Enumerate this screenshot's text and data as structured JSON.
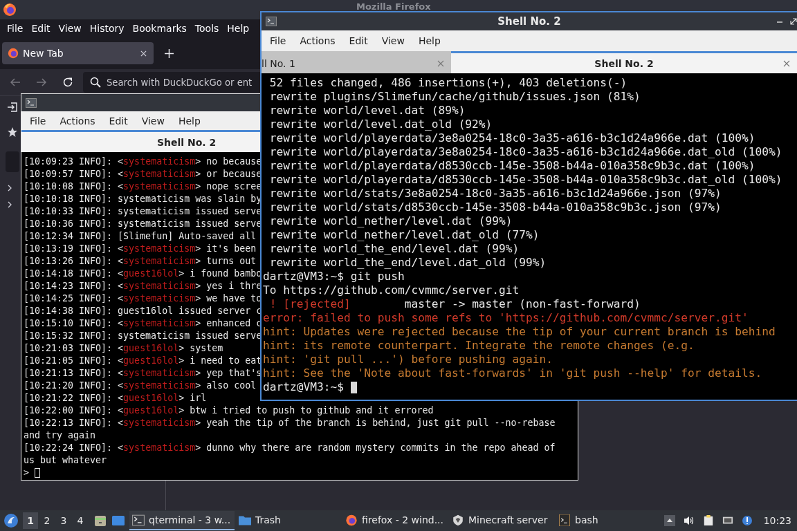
{
  "firefox": {
    "title": "Mozilla Firefox",
    "menu": [
      "File",
      "Edit",
      "View",
      "History",
      "Bookmarks",
      "Tools",
      "Help"
    ],
    "tabs": [
      {
        "label": "New Tab",
        "selected": true
      }
    ],
    "search": {
      "placeholder": "Search with DuckDuckGo or ent"
    }
  },
  "left_terminal": {
    "focused": false,
    "menu": [
      "File",
      "Actions",
      "Edit",
      "View",
      "Help"
    ],
    "tabs": [
      {
        "label": "Shell No. 2",
        "selected": true
      }
    ],
    "lines": [
      {
        "parts": [
          {
            "text": "[10:09:23 INFO]: <",
            "kind": "plain"
          },
          {
            "text": "systematicism",
            "kind": "name"
          },
          {
            "text": "> no because",
            "kind": "plain"
          }
        ]
      },
      {
        "parts": [
          {
            "text": "[10:09:57 INFO]: <",
            "kind": "plain"
          },
          {
            "text": "systematicism",
            "kind": "name"
          },
          {
            "text": "> or because",
            "kind": "plain"
          }
        ]
      },
      {
        "parts": [
          {
            "text": "[10:10:08 INFO]: <",
            "kind": "plain"
          },
          {
            "text": "systematicism",
            "kind": "name"
          },
          {
            "text": "> nope scree",
            "kind": "plain"
          }
        ]
      },
      {
        "parts": [
          {
            "text": "[10:10:18 INFO]: systematicism was slain by",
            "kind": "plain"
          }
        ]
      },
      {
        "parts": [
          {
            "text": "[10:10:33 INFO]: systematicism issued serve",
            "kind": "plain"
          }
        ]
      },
      {
        "parts": [
          {
            "text": "[10:10:36 INFO]: systematicism issued serve",
            "kind": "plain"
          }
        ]
      },
      {
        "parts": [
          {
            "text": "[10:12:34 INFO]: [Slimefun] Auto-saved all",
            "kind": "plain"
          }
        ]
      },
      {
        "parts": [
          {
            "text": "[10:13:19 INFO]: <",
            "kind": "plain"
          },
          {
            "text": "systematicism",
            "kind": "name"
          },
          {
            "text": "> it's been",
            "kind": "plain"
          }
        ]
      },
      {
        "parts": [
          {
            "text": "[10:13:26 INFO]: <",
            "kind": "plain"
          },
          {
            "text": "systematicism",
            "kind": "name"
          },
          {
            "text": "> turns out",
            "kind": "plain"
          }
        ]
      },
      {
        "parts": [
          {
            "text": "[10:14:18 INFO]: <",
            "kind": "plain"
          },
          {
            "text": "guest16lol",
            "kind": "name"
          },
          {
            "text": "> i found bambo",
            "kind": "plain"
          }
        ]
      },
      {
        "parts": [
          {
            "text": "[10:14:23 INFO]: <",
            "kind": "plain"
          },
          {
            "text": "systematicism",
            "kind": "name"
          },
          {
            "text": "> yes i thre",
            "kind": "plain"
          }
        ]
      },
      {
        "parts": [
          {
            "text": "[10:14:25 INFO]: <",
            "kind": "plain"
          },
          {
            "text": "systematicism",
            "kind": "name"
          },
          {
            "text": "> we have to",
            "kind": "plain"
          }
        ]
      },
      {
        "parts": [
          {
            "text": "[10:14:38 INFO]: guest16lol issued server c",
            "kind": "plain"
          }
        ]
      },
      {
        "parts": [
          {
            "text": "[10:15:10 INFO]: <",
            "kind": "plain"
          },
          {
            "text": "systematicism",
            "kind": "name"
          },
          {
            "text": "> enhanced c",
            "kind": "plain"
          }
        ]
      },
      {
        "parts": [
          {
            "text": "[10:15:32 INFO]: systematicism issued serve",
            "kind": "plain"
          }
        ]
      },
      {
        "parts": [
          {
            "text": "[10:21:03 INFO]: <",
            "kind": "plain"
          },
          {
            "text": "guest16lol",
            "kind": "name"
          },
          {
            "text": "> system",
            "kind": "plain"
          }
        ]
      },
      {
        "parts": [
          {
            "text": "[10:21:05 INFO]: <",
            "kind": "plain"
          },
          {
            "text": "guest16lol",
            "kind": "name"
          },
          {
            "text": "> i need to eat",
            "kind": "plain"
          }
        ]
      },
      {
        "parts": [
          {
            "text": "[10:21:13 INFO]: <",
            "kind": "plain"
          },
          {
            "text": "systematicism",
            "kind": "name"
          },
          {
            "text": "> yep that's",
            "kind": "plain"
          }
        ]
      },
      {
        "parts": [
          {
            "text": "[10:21:20 INFO]: <",
            "kind": "plain"
          },
          {
            "text": "systematicism",
            "kind": "name"
          },
          {
            "text": "> also cool",
            "kind": "plain"
          }
        ]
      },
      {
        "parts": [
          {
            "text": "[10:21:22 INFO]: <",
            "kind": "plain"
          },
          {
            "text": "guest16lol",
            "kind": "name"
          },
          {
            "text": "> irl",
            "kind": "plain"
          }
        ]
      },
      {
        "parts": [
          {
            "text": "[10:22:00 INFO]: <",
            "kind": "plain"
          },
          {
            "text": "guest16lol",
            "kind": "name"
          },
          {
            "text": "> btw i tried to push to github and it errored",
            "kind": "plain"
          }
        ]
      },
      {
        "parts": [
          {
            "text": "[10:22:13 INFO]: <",
            "kind": "plain"
          },
          {
            "text": "systematicism",
            "kind": "name"
          },
          {
            "text": "> yeah the tip of the branch is behind, just git pull --no-rebase",
            "kind": "plain"
          }
        ]
      },
      {
        "parts": [
          {
            "text": "and try again",
            "kind": "plain"
          }
        ]
      },
      {
        "parts": [
          {
            "text": "[10:22:24 INFO]: <",
            "kind": "plain"
          },
          {
            "text": "systematicism",
            "kind": "name"
          },
          {
            "text": "> dunno why there are random mystery commits in the repo ahead of",
            "kind": "plain"
          }
        ]
      },
      {
        "parts": [
          {
            "text": "us but whatever",
            "kind": "plain"
          }
        ]
      },
      {
        "parts": [
          {
            "text": ">",
            "kind": "plain"
          }
        ],
        "cursor": true
      }
    ]
  },
  "right_terminal": {
    "focused": true,
    "title": "Shell No. 2",
    "menu": [
      "File",
      "Actions",
      "Edit",
      "View",
      "Help"
    ],
    "tabs": [
      {
        "label": "ll No. 1",
        "selected": false
      },
      {
        "label": "Shell No. 2",
        "selected": true
      }
    ],
    "lines": [
      {
        "parts": [
          {
            "text": " 52 files changed, 486 insertions(+), 403 deletions(-)",
            "kind": "plain"
          }
        ]
      },
      {
        "parts": [
          {
            "text": " rewrite plugins/Slimefun/cache/github/issues.json (81%)",
            "kind": "plain"
          }
        ]
      },
      {
        "parts": [
          {
            "text": " rewrite world/level.dat (89%)",
            "kind": "plain"
          }
        ]
      },
      {
        "parts": [
          {
            "text": " rewrite world/level.dat_old (92%)",
            "kind": "plain"
          }
        ]
      },
      {
        "parts": [
          {
            "text": " rewrite world/playerdata/3e8a0254-18c0-3a35-a616-b3c1d24a966e.dat (100%)",
            "kind": "plain"
          }
        ]
      },
      {
        "parts": [
          {
            "text": " rewrite world/playerdata/3e8a0254-18c0-3a35-a616-b3c1d24a966e.dat_old (100%)",
            "kind": "plain"
          }
        ]
      },
      {
        "parts": [
          {
            "text": " rewrite world/playerdata/d8530ccb-145e-3508-b44a-010a358c9b3c.dat (100%)",
            "kind": "plain"
          }
        ]
      },
      {
        "parts": [
          {
            "text": " rewrite world/playerdata/d8530ccb-145e-3508-b44a-010a358c9b3c.dat_old (100%)",
            "kind": "plain"
          }
        ]
      },
      {
        "parts": [
          {
            "text": " rewrite world/stats/3e8a0254-18c0-3a35-a616-b3c1d24a966e.json (97%)",
            "kind": "plain"
          }
        ]
      },
      {
        "parts": [
          {
            "text": " rewrite world/stats/d8530ccb-145e-3508-b44a-010a358c9b3c.json (97%)",
            "kind": "plain"
          }
        ]
      },
      {
        "parts": [
          {
            "text": " rewrite world_nether/level.dat (99%)",
            "kind": "plain"
          }
        ]
      },
      {
        "parts": [
          {
            "text": " rewrite world_nether/level.dat_old (77%)",
            "kind": "plain"
          }
        ]
      },
      {
        "parts": [
          {
            "text": " rewrite world_the_end/level.dat (99%)",
            "kind": "plain"
          }
        ]
      },
      {
        "parts": [
          {
            "text": " rewrite world_the_end/level.dat_old (99%)",
            "kind": "plain"
          }
        ]
      },
      {
        "parts": [
          {
            "text": "dartz@VM3:~$ git push",
            "kind": "plain"
          }
        ]
      },
      {
        "parts": [
          {
            "text": "To https://github.com/cvmmc/server.git",
            "kind": "plain"
          }
        ]
      },
      {
        "parts": [
          {
            "text": " ! [rejected]",
            "kind": "error"
          },
          {
            "text": "        master -> master (non-fast-forward)",
            "kind": "plain"
          }
        ]
      },
      {
        "parts": [
          {
            "text": "error: failed to push some refs to 'https://github.com/cvmmc/server.git'",
            "kind": "error"
          }
        ]
      },
      {
        "parts": [
          {
            "text": "hint: Updates were rejected because the tip of your current branch is behind",
            "kind": "hint"
          }
        ]
      },
      {
        "parts": [
          {
            "text": "hint: its remote counterpart. Integrate the remote changes (e.g.",
            "kind": "hint"
          }
        ]
      },
      {
        "parts": [
          {
            "text": "hint: 'git pull ...') before pushing again.",
            "kind": "hint"
          }
        ]
      },
      {
        "parts": [
          {
            "text": "hint: See the 'Note about fast-forwards' in 'git push --help' for details.",
            "kind": "hint"
          }
        ]
      },
      {
        "parts": [
          {
            "text": "dartz@VM3:~$",
            "kind": "plain"
          }
        ],
        "cursor": true
      }
    ]
  },
  "taskbar": {
    "workspaces": [
      {
        "label": "1",
        "selected": true
      },
      {
        "label": "2",
        "selected": false
      },
      {
        "label": "3",
        "selected": false
      },
      {
        "label": "4",
        "selected": false
      }
    ],
    "tasks": [
      {
        "label": "qterminal - 3 w...",
        "kind": "terminal",
        "selected": true
      },
      {
        "label": "Trash",
        "kind": "folder",
        "selected": false
      },
      {
        "label": "firefox - 2 wind...",
        "kind": "firefox",
        "selected": false
      },
      {
        "label": "Minecraft server",
        "kind": "minecraft",
        "selected": false
      },
      {
        "label": "bash",
        "kind": "bash",
        "selected": false
      }
    ],
    "clock": "10:23"
  }
}
